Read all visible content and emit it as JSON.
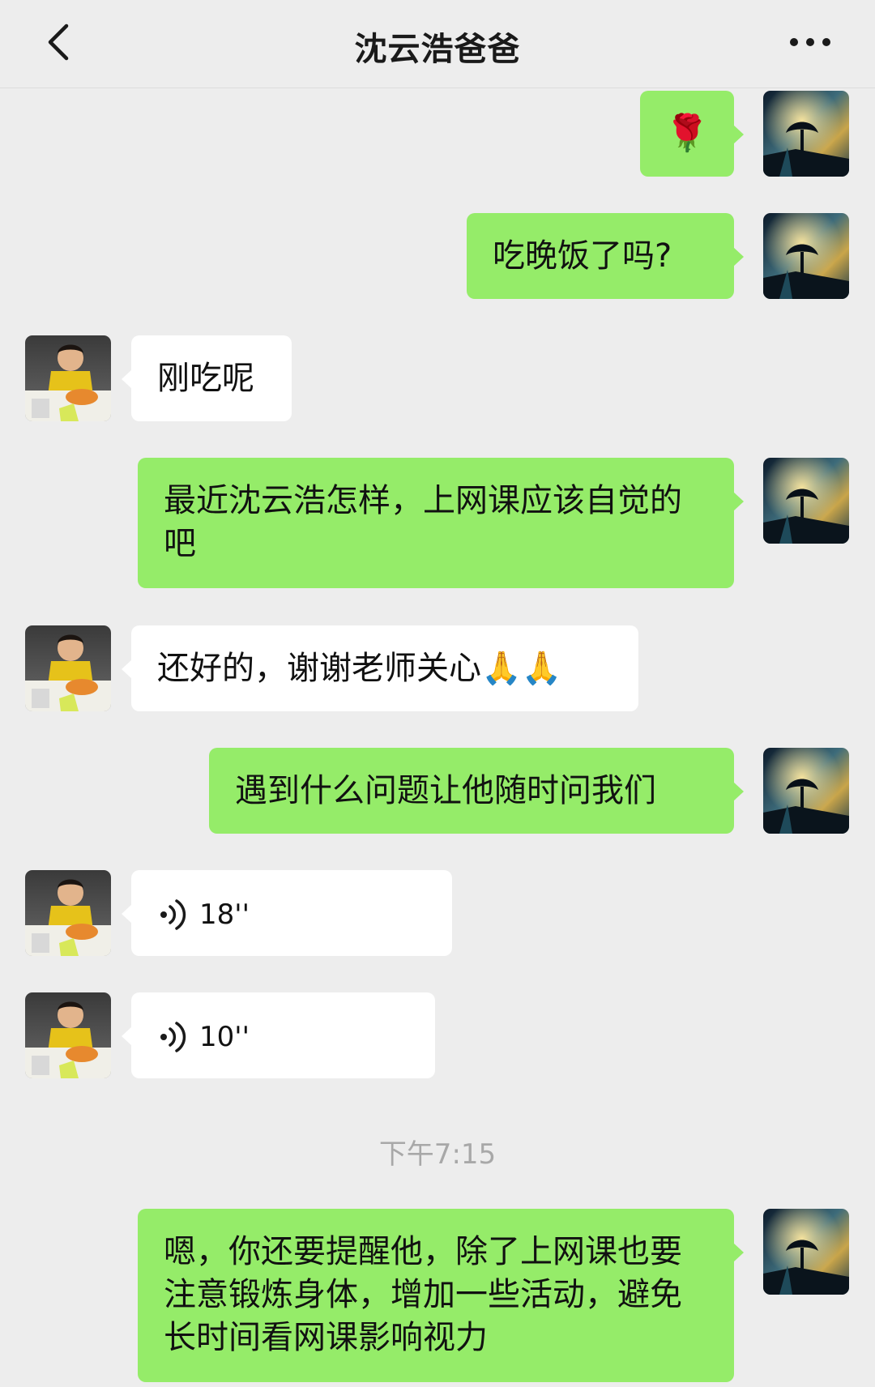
{
  "header": {
    "title": "沈云浩爸爸",
    "back_icon": "chevron-left-icon",
    "more_icon": "more-dots-icon"
  },
  "messages": [
    {
      "side": "me",
      "type": "emoji",
      "emoji": "🌹"
    },
    {
      "side": "me",
      "type": "text",
      "text": "吃晚饭了吗?"
    },
    {
      "side": "them",
      "type": "text",
      "text": "刚吃呢"
    },
    {
      "side": "me",
      "type": "text",
      "text": "最近沈云浩怎样，上网课应该自觉的吧"
    },
    {
      "side": "them",
      "type": "text",
      "text": "还好的，谢谢老师关心",
      "emoji": "🙏🙏"
    },
    {
      "side": "me",
      "type": "text",
      "text": "遇到什么问题让他随时问我们"
    },
    {
      "side": "them",
      "type": "voice",
      "duration": "18''"
    },
    {
      "side": "them",
      "type": "voice",
      "duration": "10''"
    },
    {
      "side": "me",
      "type": "text",
      "text": "嗯，你还要提醒他，除了上网课也要注意锻炼身体，增加一些活动，避免长时间看网课影响视力"
    }
  ],
  "timestamp": "下午7:15",
  "colors": {
    "background": "#ededed",
    "my_bubble": "#95ec69",
    "their_bubble": "#ffffff",
    "timestamp_text": "#a8a8a8"
  }
}
